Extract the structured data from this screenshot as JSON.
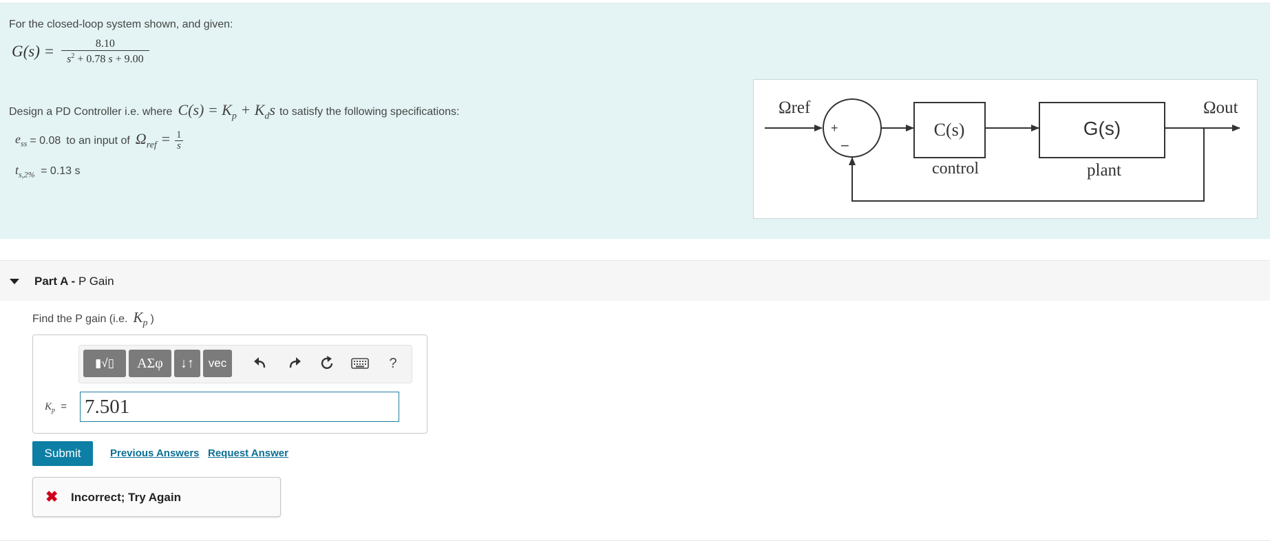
{
  "problem": {
    "intro": "For the closed-loop system shown, and given:",
    "g_lhs": "G(s) =",
    "g_numerator": "8.10",
    "g_den_coef1": "+ 0.78",
    "g_den_coef2": "+ 9.00",
    "design_prefix": "Design a PD Controller i.e. where",
    "design_suffix": "to satisfy the following specifications:",
    "ess_value": "= 0.08",
    "ess_input_text": "to an input of",
    "ts_value": "= 0.13 s"
  },
  "diagram": {
    "input_label": "Ωref",
    "output_label": "Ωout",
    "plus_sign": "+",
    "minus_sign": "−",
    "controller_block": "C(s)",
    "controller_caption": "control",
    "plant_block": "G(s)",
    "plant_caption": "plant"
  },
  "partA": {
    "label": "Part A -",
    "title": "P Gain",
    "prompt": "Find the P gain (i.e.",
    "prompt_close": ")",
    "toolbar": {
      "templates": "▮√▯",
      "symbols": "ΑΣφ",
      "arrows": "↓↑",
      "vec": "vec",
      "help": "?"
    },
    "input_label_eq": "=",
    "answer_value": "7.501",
    "submit_label": "Submit",
    "previous_answers": "Previous Answers",
    "request_answer": "Request Answer",
    "feedback_icon": "✖",
    "feedback": "Incorrect; Try Again"
  },
  "colors": {
    "panel_bg": "#e4f4f4",
    "accent": "#0d7fa5",
    "link": "#0c6f93",
    "error": "#d0021b"
  }
}
